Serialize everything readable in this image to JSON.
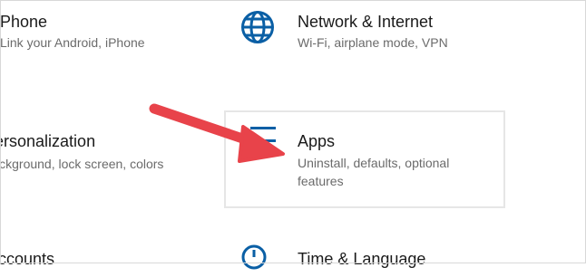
{
  "tiles": {
    "phone": {
      "title": "Phone",
      "desc": "Link your Android, iPhone",
      "icon": "phone-icon"
    },
    "network": {
      "title": "Network & Internet",
      "desc": "Wi-Fi, airplane mode, VPN",
      "icon": "globe-icon"
    },
    "personalization": {
      "title": "Personalization",
      "desc": "Background, lock screen, colors",
      "icon": "brush-icon"
    },
    "apps": {
      "title": "Apps",
      "desc_line1": "Uninstall, defaults, optional",
      "desc_line2": "features",
      "icon": "apps-list-icon"
    },
    "accounts": {
      "title": "Accounts",
      "icon": "person-icon"
    },
    "time": {
      "title": "Time & Language",
      "icon": "time-language-icon"
    }
  },
  "colors": {
    "accent": "#0a5fa5",
    "arrow": "#e8434a",
    "text": "#1a1a1a",
    "muted": "#6b6b6b"
  }
}
